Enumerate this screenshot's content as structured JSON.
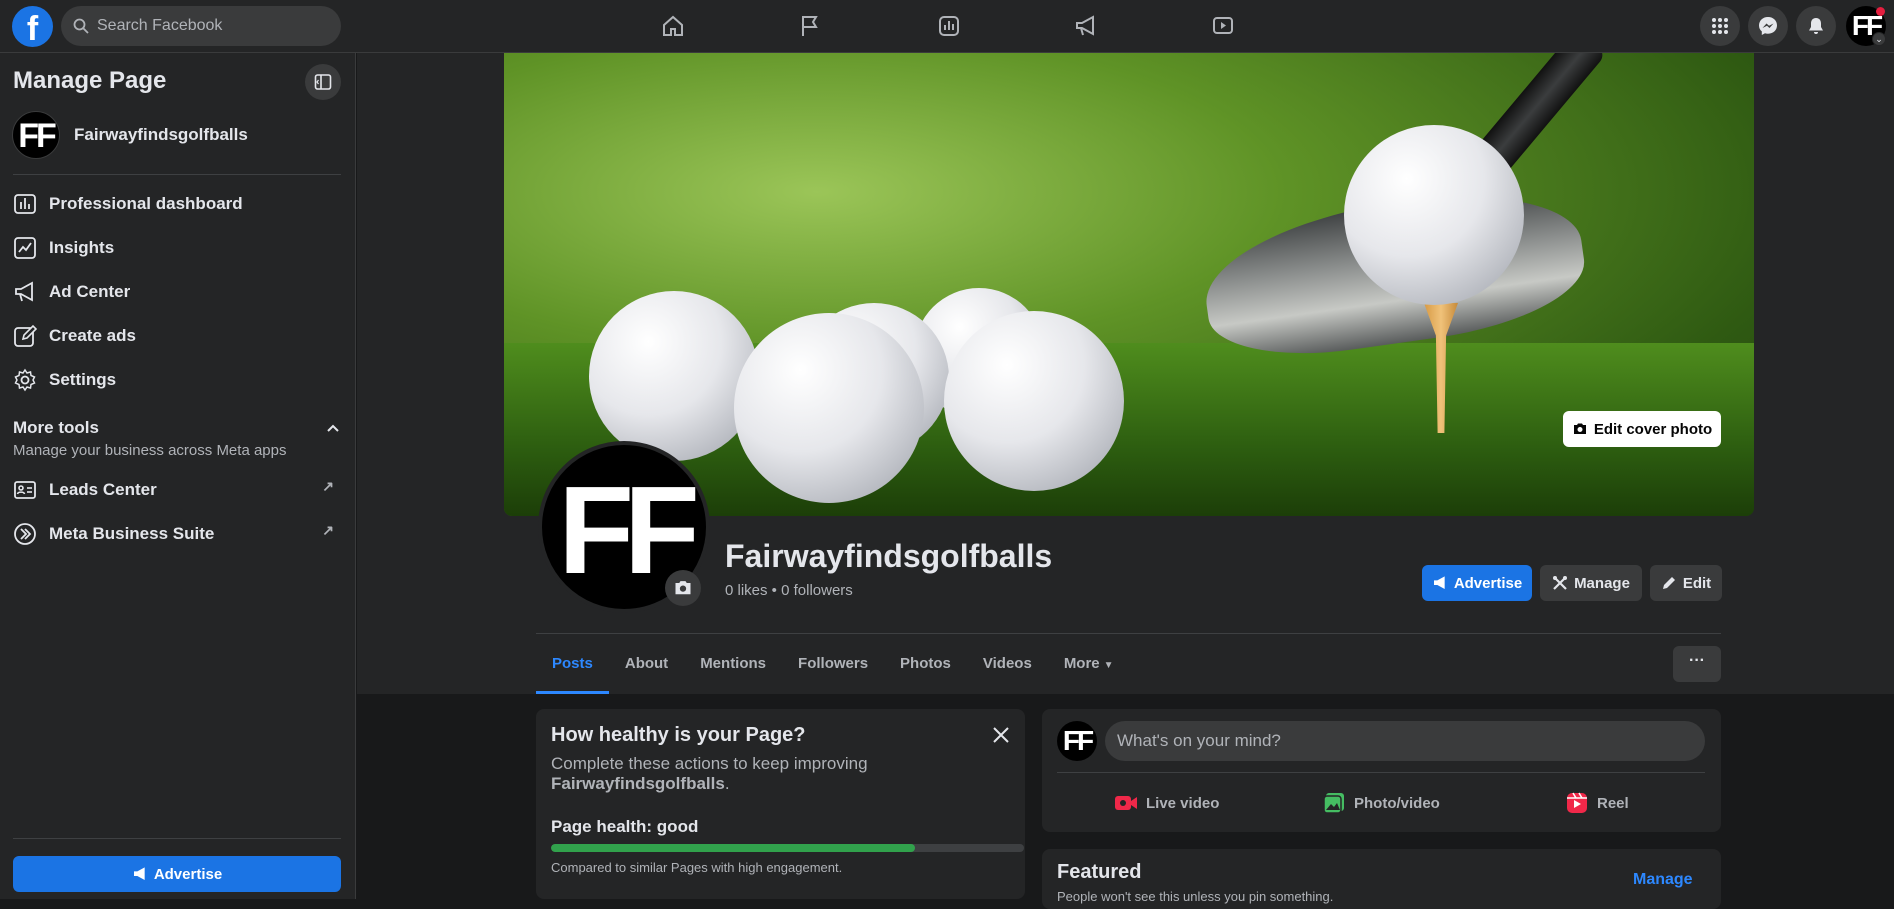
{
  "topbar": {
    "logo_letter": "f",
    "search_placeholder": "Search Facebook",
    "nav_icons": [
      "home-icon",
      "flag-icon",
      "insights-icon",
      "megaphone-icon",
      "video-icon"
    ],
    "right_icons": [
      "menu-grid-icon",
      "messenger-icon",
      "bell-icon"
    ],
    "account_initials": "FF"
  },
  "sidebar": {
    "title": "Manage Page",
    "page_name": "Fairwayfindsgolfballs",
    "page_initials": "FF",
    "items": [
      {
        "label": "Professional dashboard",
        "icon": "dashboard-icon"
      },
      {
        "label": "Insights",
        "icon": "insights-icon"
      },
      {
        "label": "Ad Center",
        "icon": "megaphone-icon"
      },
      {
        "label": "Create ads",
        "icon": "pencil-icon"
      },
      {
        "label": "Settings",
        "icon": "gear-icon"
      }
    ],
    "more_tools": {
      "title": "More tools",
      "subtitle": "Manage your business across Meta apps",
      "items": [
        {
          "label": "Leads Center",
          "icon": "leads-icon"
        },
        {
          "label": "Meta Business Suite",
          "icon": "business-suite-icon"
        }
      ]
    },
    "advertise_label": "Advertise"
  },
  "profile": {
    "edit_cover_label": "Edit cover photo",
    "initials": "FF",
    "name": "Fairwayfindsgolfballs",
    "stats": "0 likes • 0 followers",
    "buttons": {
      "advertise": "Advertise",
      "manage": "Manage",
      "edit": "Edit"
    },
    "tabs": [
      "Posts",
      "About",
      "Mentions",
      "Followers",
      "Photos",
      "Videos",
      "More"
    ],
    "active_tab": "Posts",
    "ellipsis": "···"
  },
  "health": {
    "title": "How healthy is your Page?",
    "desc": "Complete these actions to keep improving",
    "desc_page": "Fairwayfindsgolfballs",
    "status": "Page health: good",
    "progress": 0.77,
    "note": "Compared to similar Pages with high engagement."
  },
  "composer": {
    "initials": "FF",
    "placeholder": "What's on your mind?",
    "actions": [
      {
        "label": "Live video",
        "icon": "live-video-icon",
        "color": "#f02849"
      },
      {
        "label": "Photo/video",
        "icon": "photo-icon",
        "color": "#45bd62"
      },
      {
        "label": "Reel",
        "icon": "reel-icon",
        "color": "#f02849"
      }
    ]
  },
  "featured": {
    "title": "Featured",
    "subtitle": "People won't see this unless you pin something.",
    "manage_label": "Manage"
  },
  "colors": {
    "accent": "#1b74e4",
    "link": "#2d88ff",
    "health_good": "#31a24c",
    "background": "#18191a",
    "surface": "#242526"
  }
}
